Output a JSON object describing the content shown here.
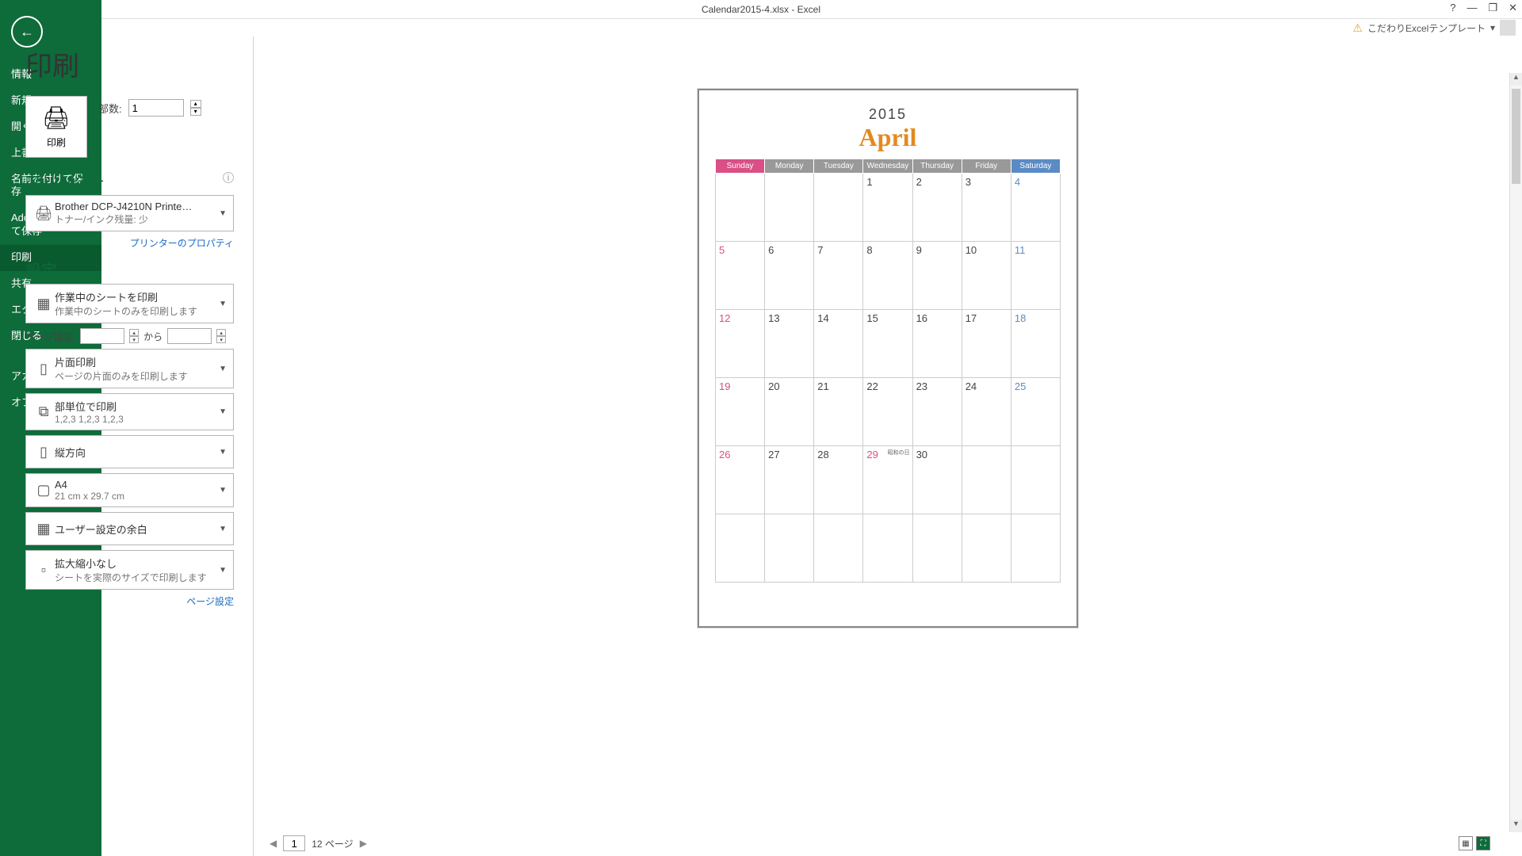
{
  "titlebar": {
    "title": "Calendar2015-4.xlsx - Excel"
  },
  "titlebar_controls": {
    "help": "?",
    "min": "—",
    "max": "❐",
    "close": "✕"
  },
  "account": {
    "label": "こだわりExcelテンプレート",
    "warning": "⚠"
  },
  "sidebar": {
    "back": "←",
    "items": [
      "情報",
      "新規",
      "開く",
      "上書き保存",
      "名前を付けて保存",
      "Adobe PDF として保存",
      "印刷",
      "共有",
      "エクスポート",
      "閉じる",
      "アカウント",
      "オプション"
    ]
  },
  "print": {
    "title": "印刷",
    "button_label": "印刷",
    "copies_label": "部数:",
    "copies_value": "1",
    "printer_header": "プリンター",
    "printer_name": "Brother DCP-J4210N Printe…",
    "printer_status": "トナー/インク残量: 少",
    "printer_props_link": "プリンターのプロパティ",
    "settings_header": "設定",
    "settings": [
      {
        "icon": "▦",
        "title": "作業中のシートを印刷",
        "sub": "作業中のシートのみを印刷します"
      }
    ],
    "pages_label": "ページ指定:",
    "pages_to": "から",
    "more_settings": [
      {
        "icon": "▯",
        "title": "片面印刷",
        "sub": "ページの片面のみを印刷します"
      },
      {
        "icon": "⧉",
        "title": "部単位で印刷",
        "sub": "1,2,3    1,2,3    1,2,3"
      },
      {
        "icon": "▯",
        "title": "縦方向",
        "sub": ""
      },
      {
        "icon": "▢",
        "title": "A4",
        "sub": "21 cm x 29.7 cm"
      },
      {
        "icon": "▦",
        "title": "ユーザー設定の余白",
        "sub": ""
      },
      {
        "icon": "▫",
        "title": "拡大縮小なし",
        "sub": "シートを実際のサイズで印刷します"
      }
    ],
    "page_setup_link": "ページ設定"
  },
  "preview": {
    "year": "2015",
    "month": "April",
    "days": [
      "Sunday",
      "Monday",
      "Tuesday",
      "Wednesday",
      "Thursday",
      "Friday",
      "Saturday"
    ],
    "weeks": [
      [
        {
          "n": ""
        },
        {
          "n": ""
        },
        {
          "n": ""
        },
        {
          "n": "1"
        },
        {
          "n": "2"
        },
        {
          "n": "3"
        },
        {
          "n": "4",
          "sat": true
        }
      ],
      [
        {
          "n": "5",
          "sun": true
        },
        {
          "n": "6"
        },
        {
          "n": "7"
        },
        {
          "n": "8"
        },
        {
          "n": "9"
        },
        {
          "n": "10"
        },
        {
          "n": "11",
          "sat": true
        }
      ],
      [
        {
          "n": "12",
          "sun": true
        },
        {
          "n": "13"
        },
        {
          "n": "14"
        },
        {
          "n": "15"
        },
        {
          "n": "16"
        },
        {
          "n": "17"
        },
        {
          "n": "18",
          "sat": true
        }
      ],
      [
        {
          "n": "19",
          "sun": true
        },
        {
          "n": "20"
        },
        {
          "n": "21"
        },
        {
          "n": "22"
        },
        {
          "n": "23"
        },
        {
          "n": "24"
        },
        {
          "n": "25",
          "sat": true
        }
      ],
      [
        {
          "n": "26",
          "sun": true
        },
        {
          "n": "27"
        },
        {
          "n": "28"
        },
        {
          "n": "29",
          "hol": true,
          "label": "昭和の日"
        },
        {
          "n": "30"
        },
        {
          "n": ""
        },
        {
          "n": ""
        }
      ],
      [
        {
          "n": ""
        },
        {
          "n": ""
        },
        {
          "n": ""
        },
        {
          "n": ""
        },
        {
          "n": ""
        },
        {
          "n": ""
        },
        {
          "n": ""
        }
      ]
    ],
    "nav": {
      "current_page": "1",
      "total": "12 ページ"
    }
  }
}
